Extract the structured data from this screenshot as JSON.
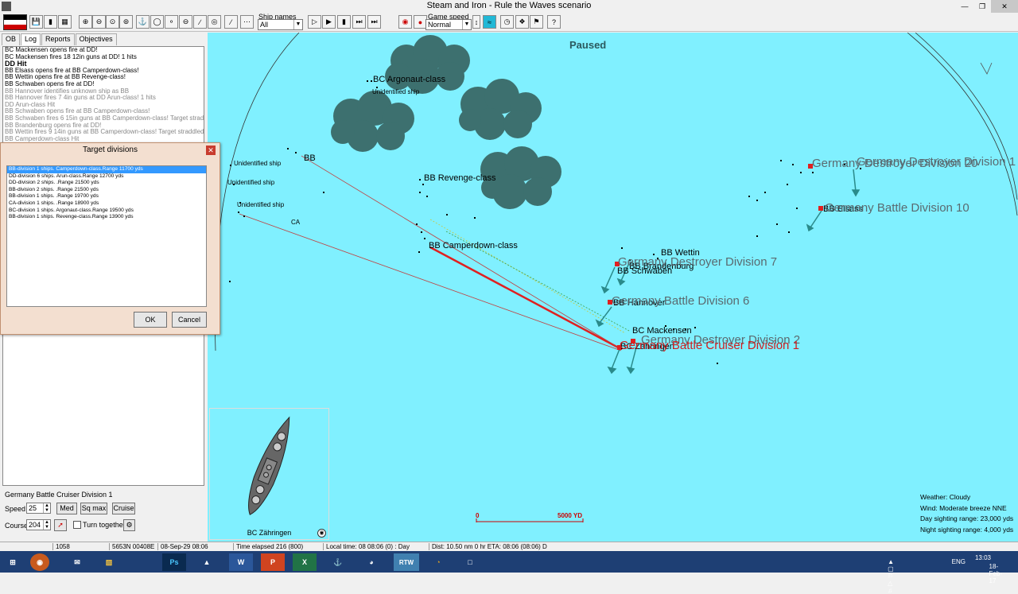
{
  "window": {
    "title": "Steam and Iron - Rule the Waves scenario"
  },
  "toolbar": {
    "ship_names_label": "Ship names",
    "ship_names_value": "All",
    "game_speed_label": "Game speed",
    "game_speed_value": "Normal"
  },
  "tabs": [
    "OB",
    "Log",
    "Reports",
    "Objectives"
  ],
  "log": [
    {
      "text": "BC Mackensen opens fire at DD!",
      "style": "normal"
    },
    {
      "text": "BC Mackensen fires 18 12in guns at DD! 1 hits",
      "style": "normal"
    },
    {
      "text": "DD Hit",
      "style": "bold"
    },
    {
      "text": "BB Elsass opens fire at BB Camperdown-class!",
      "style": "normal"
    },
    {
      "text": "BB Wettin opens fire at BB Revenge-class!",
      "style": "normal"
    },
    {
      "text": "BB Schwaben opens fire at DD!",
      "style": "normal"
    },
    {
      "text": "BB Hannover identifies unknown ship as BB",
      "style": "dim"
    },
    {
      "text": "BB Hannover fires 7 4in guns at DD Arun-class! 1 hits",
      "style": "dim"
    },
    {
      "text": "DD Arun-class Hit",
      "style": "dim"
    },
    {
      "text": "BB Schwaben opens fire at BB Camperdown-class!",
      "style": "dim"
    },
    {
      "text": "BB Schwaben fires 6 15in guns at BB Camperdown-class! Target straddled! 0",
      "style": "dim"
    },
    {
      "text": "BB Brandenburg opens fire at DD!",
      "style": "dim"
    },
    {
      "text": "BB Wettin fires 9 14in guns at BB Camperdown-class! Target straddled! 2 hits",
      "style": "dim"
    },
    {
      "text": "BB Camperdown-class Hit",
      "style": "dim"
    }
  ],
  "dialog": {
    "title": "Target divisions",
    "items": [
      "BB-division 1 ships. Camperdown-class.Range 11700 yds",
      "DD-division 6 ships. Arun-class.Range 12700 yds",
      "DD-division 2 ships. .Range 21500 yds",
      "BB-division 2 ships. .Range 21500 yds",
      "BB-division 1 ships. .Range 19700 yds",
      "CA-division 1 ships. .Range 18900 yds",
      "BC-division 1 ships. Argonaut-class.Range 19500 yds",
      "BB-division 1 ships. Revenge-class.Range 13900 yds"
    ],
    "selected_index": 0,
    "ok_label": "OK",
    "cancel_label": "Cancel"
  },
  "controls": {
    "division_name": "Germany Battle Cruiser Division 1",
    "speed_label": "Speed",
    "speed_value": "25",
    "med_label": "Med",
    "sqmax_label": "Sq max",
    "cruise_label": "Cruise",
    "course_label": "Course",
    "course_value": "204",
    "turn_together_label": "Turn together"
  },
  "map": {
    "status": "Paused",
    "ship_labels": [
      {
        "text": "BC Argonaut-class",
        "size": "big"
      },
      {
        "text": "Unidentified ship",
        "size": "small"
      },
      {
        "text": "Unidentified ship",
        "size": "small"
      },
      {
        "text": "BB",
        "size": "big"
      },
      {
        "text": "Unidentified ship",
        "size": "small"
      },
      {
        "text": "Unidentified ship",
        "size": "small"
      },
      {
        "text": "CA",
        "size": "small"
      },
      {
        "text": "BB Revenge-class",
        "size": "big"
      },
      {
        "text": "BB Camperdown-class",
        "size": "big"
      },
      {
        "text": "BB Wettin",
        "size": "big"
      },
      {
        "text": "BB Brandenburg",
        "size": "big"
      },
      {
        "text": "BB Schwaben",
        "size": "big"
      },
      {
        "text": "BB Hannover",
        "size": "big"
      },
      {
        "text": "BC Mackensen",
        "size": "big"
      },
      {
        "text": "BC Zähringen",
        "size": "big"
      },
      {
        "text": "BB Elsass",
        "size": "big"
      }
    ],
    "division_labels": [
      {
        "text": "Germany Destroyer Division 1",
        "color": "grey"
      },
      {
        "text": "Germany Destroyer Division 20",
        "color": "grey"
      },
      {
        "text": "Germany Battle Division 10",
        "color": "grey"
      },
      {
        "text": "Germany Destroyer Division 7",
        "color": "grey"
      },
      {
        "text": "Germany Battle Division 6",
        "color": "grey"
      },
      {
        "text": "Germany Destroyer Division 2",
        "color": "grey"
      },
      {
        "text": "Germany Battle Cruiser Division 1",
        "color": "red"
      }
    ],
    "scale": {
      "start": "0",
      "end": "5000 YD"
    },
    "weather": [
      "Weather: Cloudy",
      "Wind: Moderate breeze  NNE",
      "Day sighting range: 23,000 yds",
      "Night sighting range: 4,000 yds"
    ]
  },
  "preview": {
    "caption": "BC Zähringen"
  },
  "statusbar": {
    "field1": "1058",
    "field2": "5653N 00408E",
    "field3": "08-Sep-29 08:06",
    "field4": "Time elapsed 216 (800)",
    "field5": "Local time: 08 08:06 (0) : Day",
    "field6": "Dist: 10.50 nm 0 hr ETA: 08:06 (08:06) D"
  },
  "taskbar": {
    "apps": [
      "firefox-icon",
      "mail-icon",
      "folder-icon",
      "photoshop-icon",
      "steam-icon",
      "word-icon",
      "powerpoint-icon",
      "excel-icon",
      "wows-icon",
      "compass-icon",
      "rtw-icon",
      "headphones-icon",
      "window-icon"
    ],
    "app_labels": {
      "photoshop": "Ps",
      "word": "W",
      "powerpoint": "P",
      "excel": "X",
      "rtw": "RTW"
    },
    "lang": "ENG",
    "time": "13:03",
    "date": "18-Feb-17"
  },
  "colors": {
    "sea": "#80f0ff",
    "cloud": "#3d706f",
    "fire_line": "#e02020",
    "division_grey": "#5a6a70",
    "division_red": "#d02020"
  }
}
